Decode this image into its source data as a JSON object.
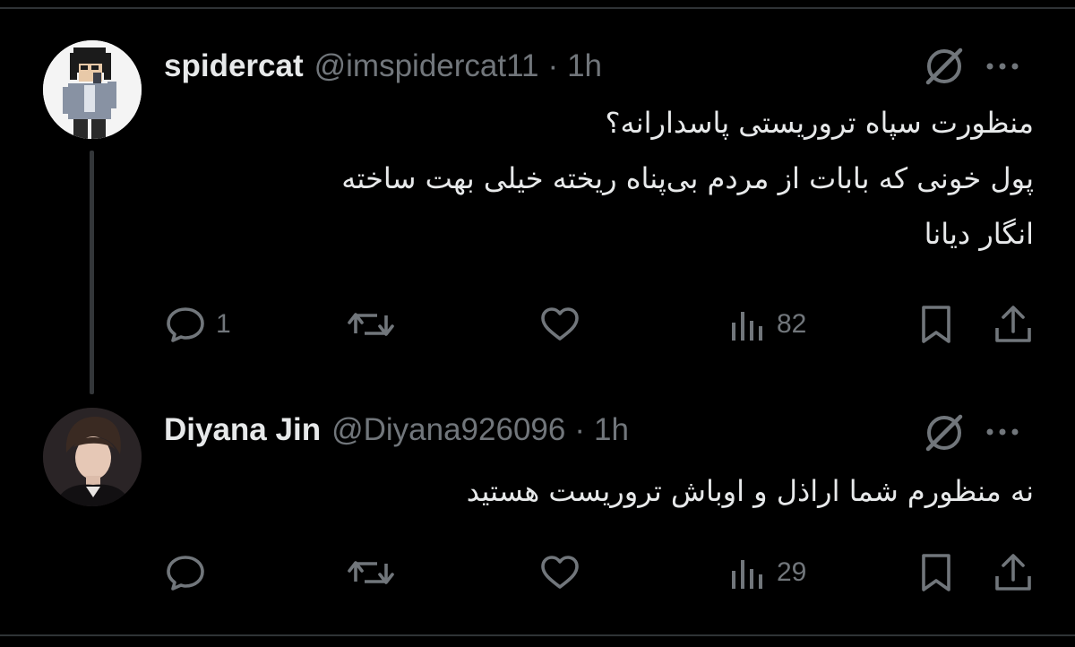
{
  "colors": {
    "background": "#000000",
    "primary_text": "#e7e9ea",
    "secondary_text": "#71767b",
    "divider": "#2f3336"
  },
  "tweets": [
    {
      "display_name": "spidercat",
      "handle": "@imspidercat11",
      "separator": "·",
      "time": "1h",
      "avatar": "pixel-art-character-avatar",
      "text_lines": [
        "منظورت سپاه تروریستی پاسدارانه؟",
        "پول خونی که بابات از مردم بی‌پناه ریخته خیلی بهت ساخته",
        "انگار دیانا"
      ],
      "actions": {
        "replies": "1",
        "retweets": "",
        "likes": "",
        "views": "82"
      }
    },
    {
      "display_name": "Diyana Jin",
      "handle": "@Diyana926096",
      "separator": "·",
      "time": "1h",
      "avatar": "photo-avatar",
      "text_lines": [
        "نه منظورم شما اراذل و اوباش تروریست هستید"
      ],
      "actions": {
        "replies": "",
        "retweets": "",
        "likes": "",
        "views": "29"
      }
    }
  ]
}
